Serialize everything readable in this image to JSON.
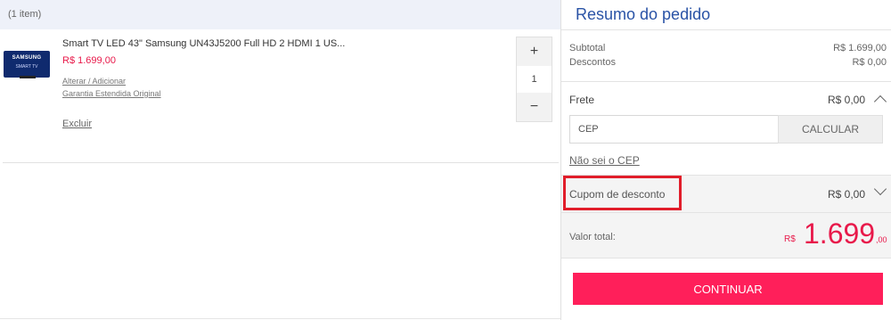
{
  "cart": {
    "item_count": "(1 item)",
    "items": [
      {
        "title": "Smart TV LED 43\" Samsung UN43J5200 Full HD 2 HDMI 1 US...",
        "price": "R$ 1.699,00",
        "thumb_brand": "SAMSUNG",
        "thumb_sub": "SMART TV",
        "link_alterar": "Alterar / Adicionar",
        "link_garantia": "Garantia Estendida Original",
        "remove_label": "Excluir",
        "quantity": "1",
        "plus_label": "+",
        "minus_label": "−"
      }
    ]
  },
  "summary": {
    "title": "Resumo do pedido",
    "subtotal_label": "Subtotal",
    "subtotal_value": "R$ 1.699,00",
    "discount_label": "Descontos",
    "discount_value": "R$ 0,00",
    "shipping_label": "Frete",
    "shipping_value": "R$ 0,00",
    "cep_placeholder": "CEP",
    "calc_label": "CALCULAR",
    "cep_help": "Não sei o CEP",
    "coupon_label": "Cupom de desconto",
    "coupon_value": "R$ 0,00",
    "total_label": "Valor total:",
    "total_currency": "R$",
    "total_int": "1.699",
    "total_dec": ",00",
    "continue_label": "CONTINUAR"
  },
  "colors": {
    "accent_blue": "#2a53a6",
    "price_red": "#e8194a",
    "cta_pink": "#ff1f5a",
    "highlight_red": "#e11d2a"
  }
}
